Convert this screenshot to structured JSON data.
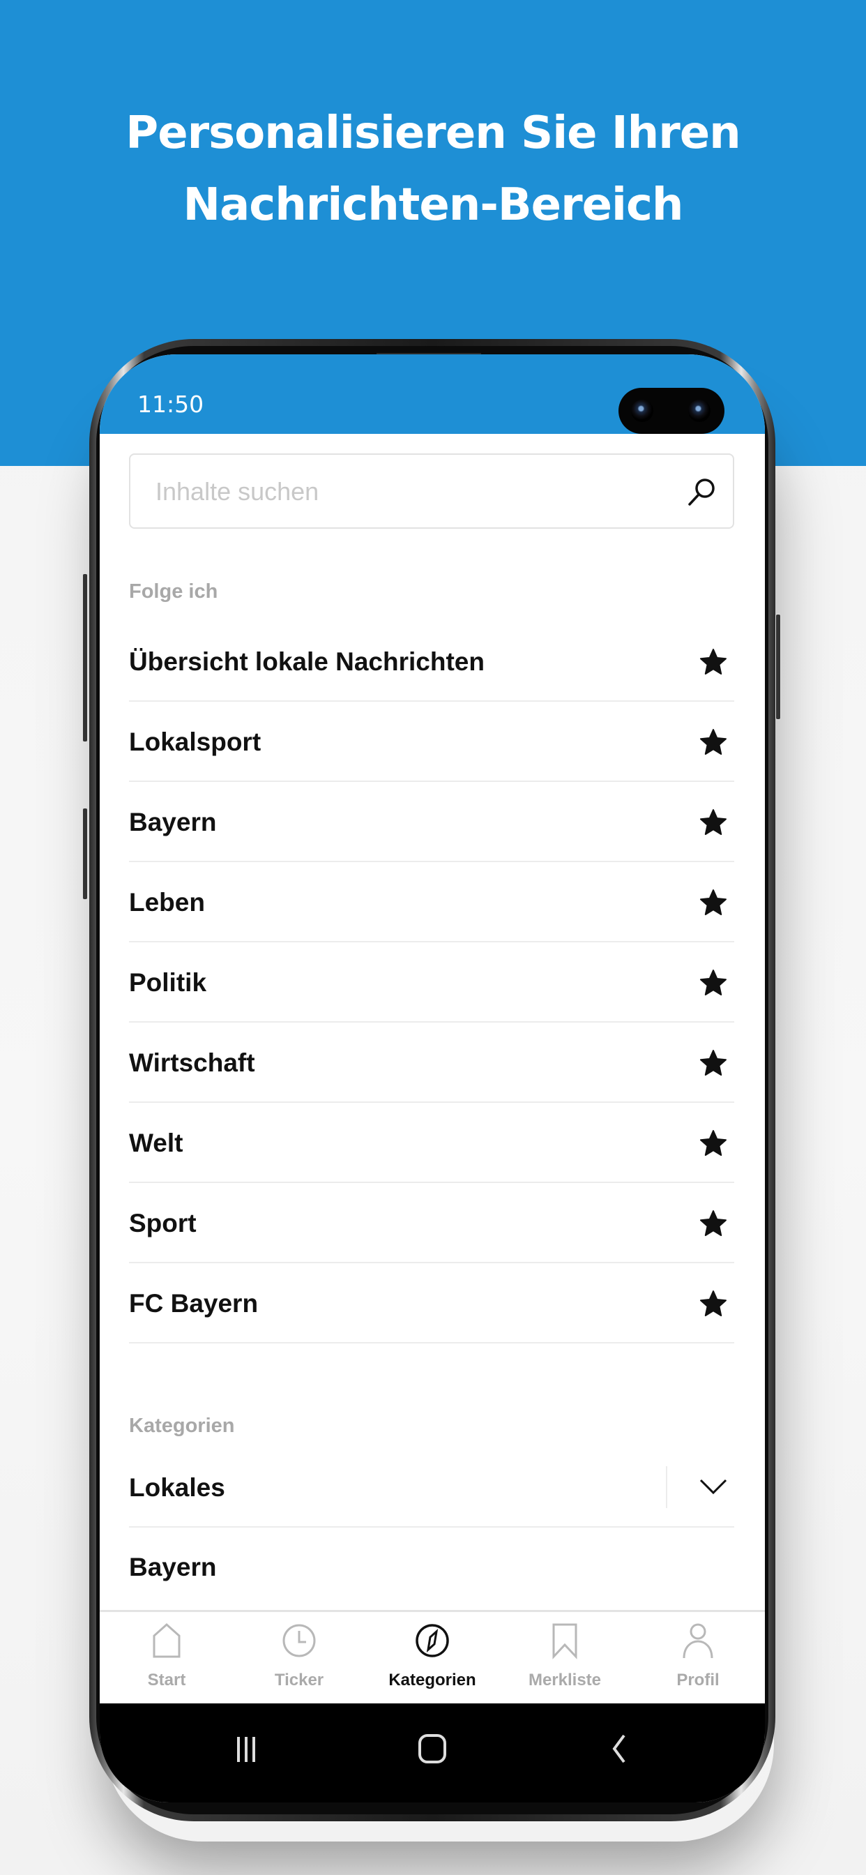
{
  "headline": {
    "line1": "Personalisieren Sie Ihren",
    "line2": "Nachrichten-Bereich"
  },
  "colors": {
    "brand_blue": "#1e8fd5",
    "text_primary": "#111111",
    "text_muted": "#a8a8a8"
  },
  "statusbar": {
    "time": "11:50"
  },
  "search": {
    "placeholder": "Inhalte suchen",
    "icon": "search-icon"
  },
  "followed": {
    "section_label": "Folge ich",
    "items": [
      {
        "label": "Übersicht lokale Nachrichten",
        "icon": "star-filled-icon",
        "following": true
      },
      {
        "label": "Lokalsport",
        "icon": "star-filled-icon",
        "following": true
      },
      {
        "label": "Bayern",
        "icon": "star-filled-icon",
        "following": true
      },
      {
        "label": "Leben",
        "icon": "star-filled-icon",
        "following": true
      },
      {
        "label": "Politik",
        "icon": "star-filled-icon",
        "following": true
      },
      {
        "label": "Wirtschaft",
        "icon": "star-filled-icon",
        "following": true
      },
      {
        "label": "Welt",
        "icon": "star-filled-icon",
        "following": true
      },
      {
        "label": "Sport",
        "icon": "star-filled-icon",
        "following": true
      },
      {
        "label": "FC Bayern",
        "icon": "star-filled-icon",
        "following": true
      }
    ]
  },
  "categories": {
    "section_label": "Kategorien",
    "items": [
      {
        "label": "Lokales",
        "expandable": true,
        "icon": "chevron-down-icon"
      },
      {
        "label": "Bayern"
      }
    ]
  },
  "tabbar": {
    "tabs": [
      {
        "label": "Start",
        "icon": "home-icon",
        "active": false
      },
      {
        "label": "Ticker",
        "icon": "clock-icon",
        "active": false
      },
      {
        "label": "Kategorien",
        "icon": "compass-icon",
        "active": true
      },
      {
        "label": "Merkliste",
        "icon": "bookmark-icon",
        "active": false
      },
      {
        "label": "Profil",
        "icon": "user-icon",
        "active": false
      }
    ]
  },
  "system_nav": {
    "buttons": [
      "recent-apps-icon",
      "home-button-icon",
      "back-icon"
    ]
  }
}
